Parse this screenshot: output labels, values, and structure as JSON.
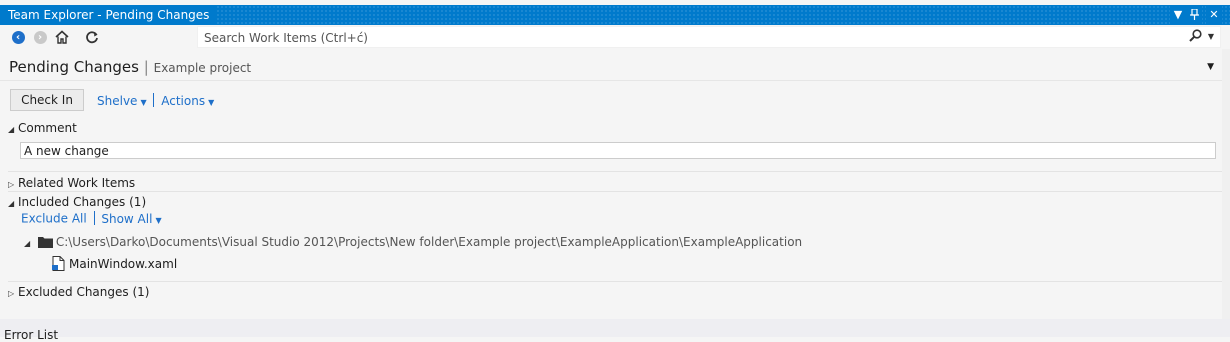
{
  "window": {
    "title": "Team Explorer - Pending Changes",
    "accent_color": "#007acc",
    "buttons": [
      {
        "name": "dropdown-icon",
        "glyph": "▼"
      },
      {
        "name": "pin-icon",
        "glyph": "⊥"
      },
      {
        "name": "close-icon",
        "glyph": "✕"
      }
    ]
  },
  "toolbar": {
    "back_icon": "back-arrow-icon",
    "forward_icon": "forward-arrow-icon",
    "home_icon": "home-icon",
    "refresh_icon": "refresh-icon",
    "search_placeholder": "Search Work Items (Ctrl+ć)"
  },
  "header": {
    "title": "Pending Changes",
    "separator": "|",
    "project": "Example project"
  },
  "actions": {
    "checkin_label": "Check In",
    "shelve_label": "Shelve",
    "actions_label": "Actions"
  },
  "comment": {
    "section_label": "Comment",
    "value": "A new change"
  },
  "related": {
    "section_label": "Related Work Items"
  },
  "included": {
    "section_label": "Included Changes (1)",
    "exclude_all": "Exclude All",
    "show_all": "Show All",
    "folder_path": "C:\\Users\\Darko\\Documents\\Visual Studio 2012\\Projects\\New folder\\Example project\\ExampleApplication\\ExampleApplication",
    "files": [
      "MainWindow.xaml"
    ]
  },
  "excluded": {
    "section_label": "Excluded Changes (1)"
  },
  "bottom": {
    "error_list_label": "Error List"
  },
  "colors": {
    "link": "#1e6fc9",
    "background": "#f5f5f5"
  }
}
